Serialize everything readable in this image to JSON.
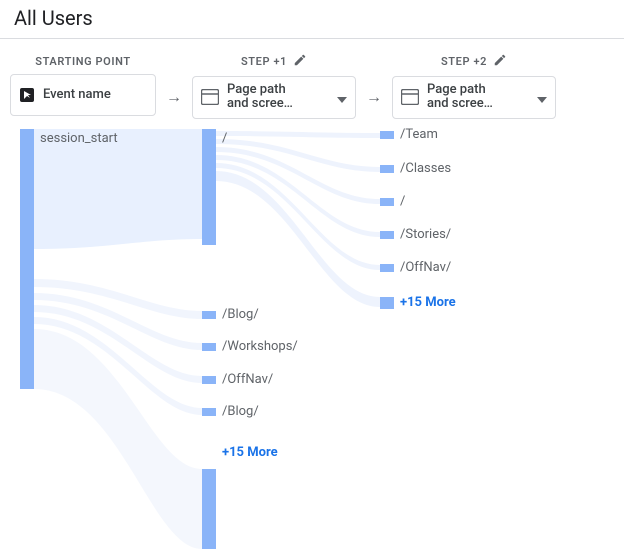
{
  "title": "All Users",
  "columns": [
    {
      "label": "STARTING POINT",
      "selector": "Event name",
      "editable": false
    },
    {
      "label": "STEP +1",
      "selector_line1": "Page path",
      "selector_line2": "and scree…",
      "editable": true
    },
    {
      "label": "STEP +2",
      "selector_line1": "Page path",
      "selector_line2": "and scree…",
      "editable": true
    }
  ],
  "col0": {
    "items": [
      "session_start"
    ]
  },
  "col1": {
    "items": [
      "/",
      "/Blog/",
      "/Workshops/",
      "/OffNav/",
      "/Blog/"
    ],
    "more": "+15 More"
  },
  "col2": {
    "items": [
      "/Team",
      "/Classes",
      "/",
      "/Stories/",
      "/OffNav/"
    ],
    "more": "+15 More"
  },
  "chart_data": {
    "type": "sankey",
    "title": "Path exploration — All Users",
    "columns": [
      "Starting point (Event name)",
      "Step +1 (Page path and screen class)",
      "Step +2 (Page path and screen class)"
    ],
    "nodes": [
      {
        "col": 0,
        "name": "session_start",
        "weight": 100
      },
      {
        "col": 1,
        "name": "/",
        "weight": 60
      },
      {
        "col": 1,
        "name": "/Blog/",
        "weight": 6
      },
      {
        "col": 1,
        "name": "/Workshops/",
        "weight": 5
      },
      {
        "col": 1,
        "name": "/OffNav/",
        "weight": 5
      },
      {
        "col": 1,
        "name": "/Blog/",
        "weight": 4
      },
      {
        "col": 1,
        "name": "+15 More",
        "weight": 20
      },
      {
        "col": 2,
        "name": "/Team",
        "weight": 4
      },
      {
        "col": 2,
        "name": "/Classes",
        "weight": 4
      },
      {
        "col": 2,
        "name": "/",
        "weight": 4
      },
      {
        "col": 2,
        "name": "/Stories/",
        "weight": 4
      },
      {
        "col": 2,
        "name": "/OffNav/",
        "weight": 4
      },
      {
        "col": 2,
        "name": "+15 More",
        "weight": 40
      }
    ],
    "links": [
      {
        "from": "session_start",
        "to_col": 1,
        "to": "/",
        "weight": 60
      },
      {
        "from": "session_start",
        "to_col": 1,
        "to": "/Blog/",
        "weight": 6
      },
      {
        "from": "session_start",
        "to_col": 1,
        "to": "/Workshops/",
        "weight": 5
      },
      {
        "from": "session_start",
        "to_col": 1,
        "to": "/OffNav/",
        "weight": 5
      },
      {
        "from": "session_start",
        "to_col": 1,
        "to": "/Blog/",
        "weight": 4
      },
      {
        "from": "/",
        "to_col": 2,
        "to": "/Team",
        "weight": 4
      },
      {
        "from": "/",
        "to_col": 2,
        "to": "/Classes",
        "weight": 4
      },
      {
        "from": "/",
        "to_col": 2,
        "to": "/",
        "weight": 4
      },
      {
        "from": "/",
        "to_col": 2,
        "to": "/Stories/",
        "weight": 4
      },
      {
        "from": "/",
        "to_col": 2,
        "to": "/OffNav/",
        "weight": 4
      },
      {
        "from": "/",
        "to_col": 2,
        "to": "+15 More",
        "weight": 40
      }
    ]
  }
}
